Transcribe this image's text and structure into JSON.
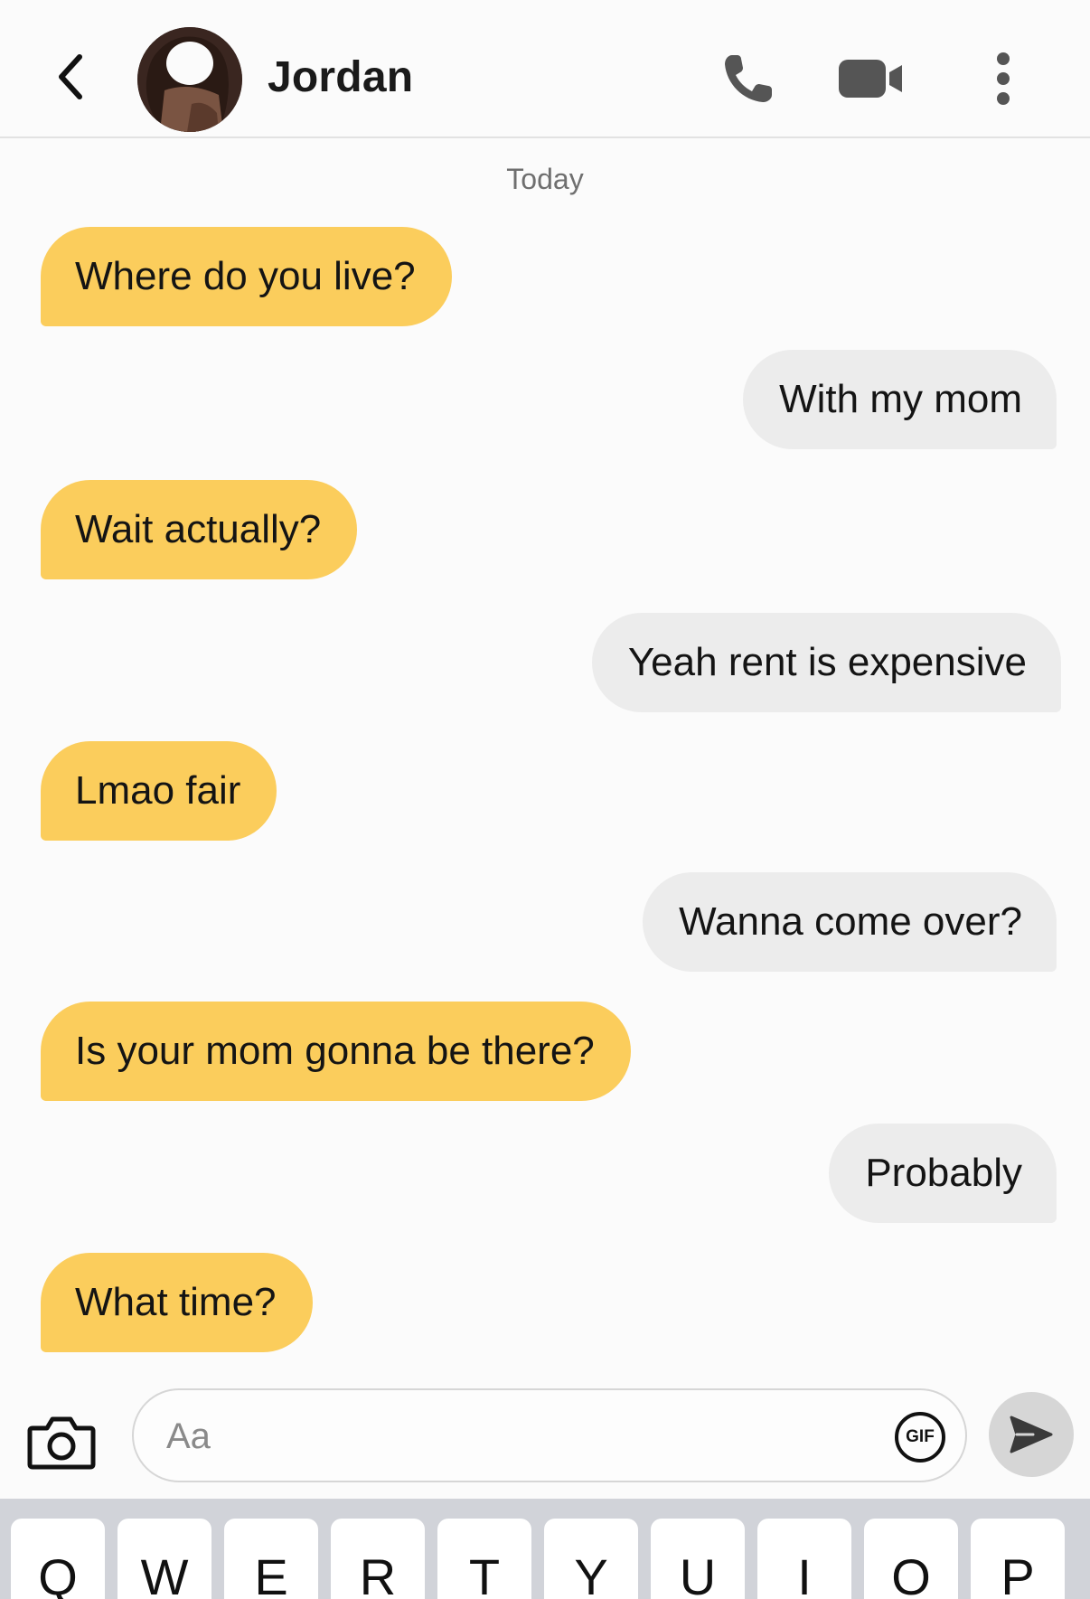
{
  "header": {
    "contact_name": "Jordan",
    "icons": {
      "back": "chevron-left-icon",
      "avatar": "avatar",
      "phone": "phone-icon",
      "video": "video-camera-icon",
      "more": "more-vertical-icon"
    }
  },
  "conversation": {
    "date_label": "Today",
    "messages": [
      {
        "direction": "incoming",
        "text": "Where do you live?"
      },
      {
        "direction": "outgoing",
        "text": "With my mom"
      },
      {
        "direction": "incoming",
        "text": "Wait actually?"
      },
      {
        "direction": "outgoing",
        "text": "Yeah rent is expensive"
      },
      {
        "direction": "incoming",
        "text": "Lmao fair"
      },
      {
        "direction": "outgoing",
        "text": "Wanna come over?"
      },
      {
        "direction": "incoming",
        "text": "Is your mom gonna be there?"
      },
      {
        "direction": "outgoing",
        "text": "Probably"
      },
      {
        "direction": "incoming",
        "text": "What time?"
      }
    ]
  },
  "composer": {
    "placeholder": "Aa",
    "gif_label": "GIF",
    "icons": {
      "camera": "camera-icon",
      "send": "send-icon"
    }
  },
  "keyboard": {
    "row1": [
      "Q",
      "W",
      "E",
      "R",
      "T",
      "Y",
      "U",
      "I",
      "O",
      "P"
    ]
  },
  "colors": {
    "incoming_bubble": "#fbcd5c",
    "outgoing_bubble": "#ececec",
    "background": "#fbfbfb",
    "keyboard_bg": "#d1d3d9"
  }
}
